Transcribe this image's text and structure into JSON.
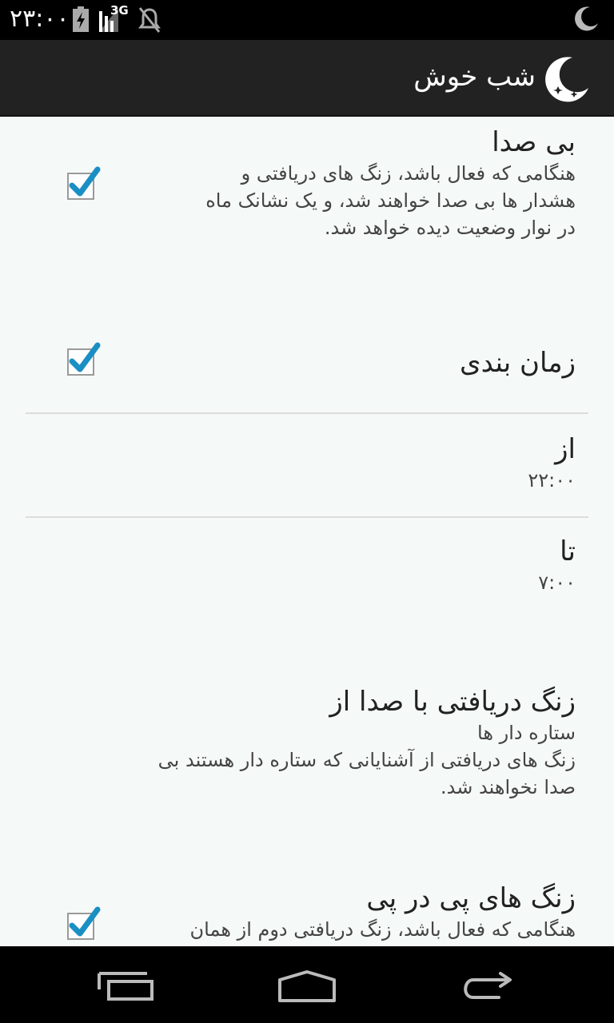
{
  "status_bar": {
    "time": "۲۳:۰۰",
    "network": "3G",
    "icons": [
      "battery-charging-icon",
      "signal-3g-icon",
      "mute-icon",
      "moon-icon"
    ]
  },
  "action_bar": {
    "title": "شب خوش",
    "logo_icon": "moon-stars-icon"
  },
  "prefs": {
    "silent": {
      "title": "بی صدا",
      "summary_1": "هنگامی که فعال باشد، زنگ های دریافتی و",
      "summary_2": "هشدار ها بی صدا خواهند شد، و یک نشانک ماه",
      "summary_3": "در نوار وضعیت دیده خواهد شد.",
      "checked": true
    },
    "schedule": {
      "title": "زمان بندی",
      "checked": true
    },
    "from": {
      "title": "از",
      "value": "۲۲:۰۰"
    },
    "to": {
      "title": "تا",
      "value": "۷:۰۰"
    },
    "ring_from": {
      "title": "زنگ دریافتی با صدا از",
      "summary_1": "ستاره دار ها",
      "summary_2": "زنگ های دریافتی از آشنایانی که ستاره دار هستند بی",
      "summary_3": "صدا نخواهند شد."
    },
    "repeated": {
      "title": "زنگ های پی در پی",
      "summary_1": "هنگامی که فعال باشد، زنگ دریافتی دوم از همان",
      "checked": true
    }
  },
  "nav_bar": {
    "recent": "recent-apps-icon",
    "home": "home-icon",
    "back": "back-icon"
  },
  "colors": {
    "accent": "#33b5e5",
    "background": "#f5f9f7",
    "action_bar": "#222222"
  }
}
